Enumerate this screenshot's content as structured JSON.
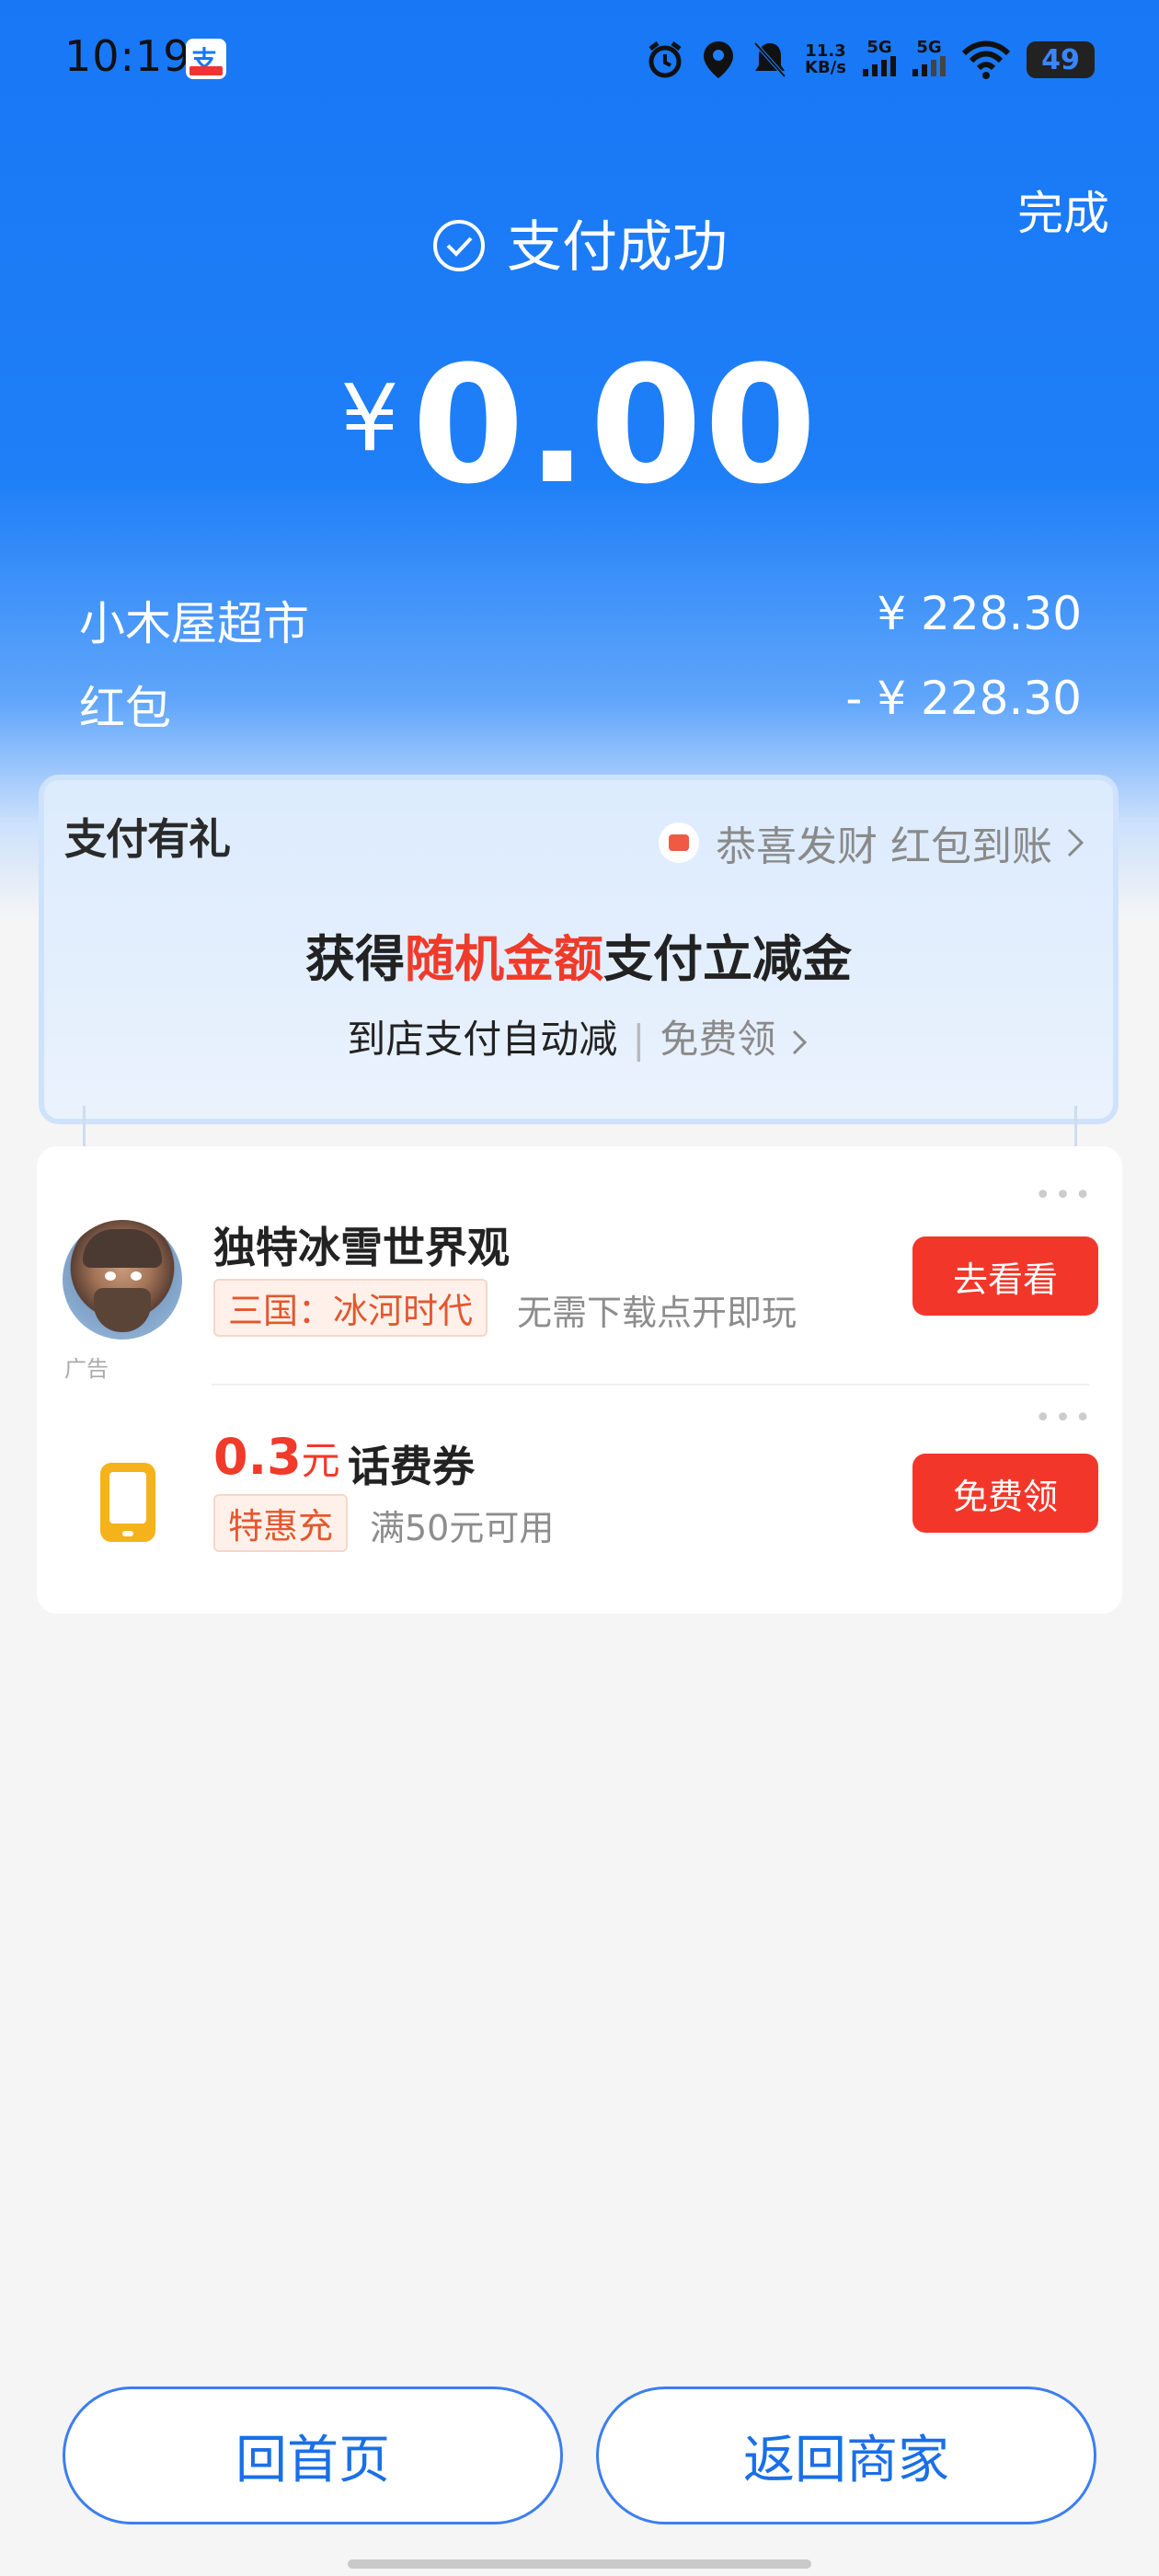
{
  "status_bar": {
    "time": "10:19",
    "speed_top": "11.3",
    "speed_unit": "KB/s",
    "net1": "5G",
    "net2": "5G",
    "battery": "49",
    "icons": [
      "alarm-icon",
      "location-icon",
      "mute-icon",
      "signal-icon",
      "wifi-icon"
    ]
  },
  "header": {
    "done_label": "完成",
    "title": "支付成功",
    "currency": "¥",
    "amount": "0.00"
  },
  "summary": {
    "merchant_label": "小木屋超市",
    "merchant_value": "¥ 228.30",
    "redpacket_label": "红包",
    "redpacket_value": "- ¥ 228.30"
  },
  "gift": {
    "title": "支付有礼",
    "tag": "恭喜发财 红包到账",
    "headline_pre": "获得",
    "headline_red": "随机金额",
    "headline_post": "支付立减金",
    "sub_left": "到店支付自动减",
    "sub_right": "免费领"
  },
  "offers": {
    "ad_label": "广告",
    "item1": {
      "title": "独特冰雪世界观",
      "tag": "三国：冰河时代",
      "desc": "无需下载点开即玩",
      "button": "去看看"
    },
    "item2": {
      "price": "0.3",
      "price_unit": "元",
      "title": "话费券",
      "tag": "特惠充",
      "desc": "满50元可用",
      "button": "免费领"
    }
  },
  "footer": {
    "home_label": "回首页",
    "back_label": "返回商家"
  },
  "colors": {
    "brand_blue": "#1677ff",
    "accent_red": "#f2372a"
  }
}
